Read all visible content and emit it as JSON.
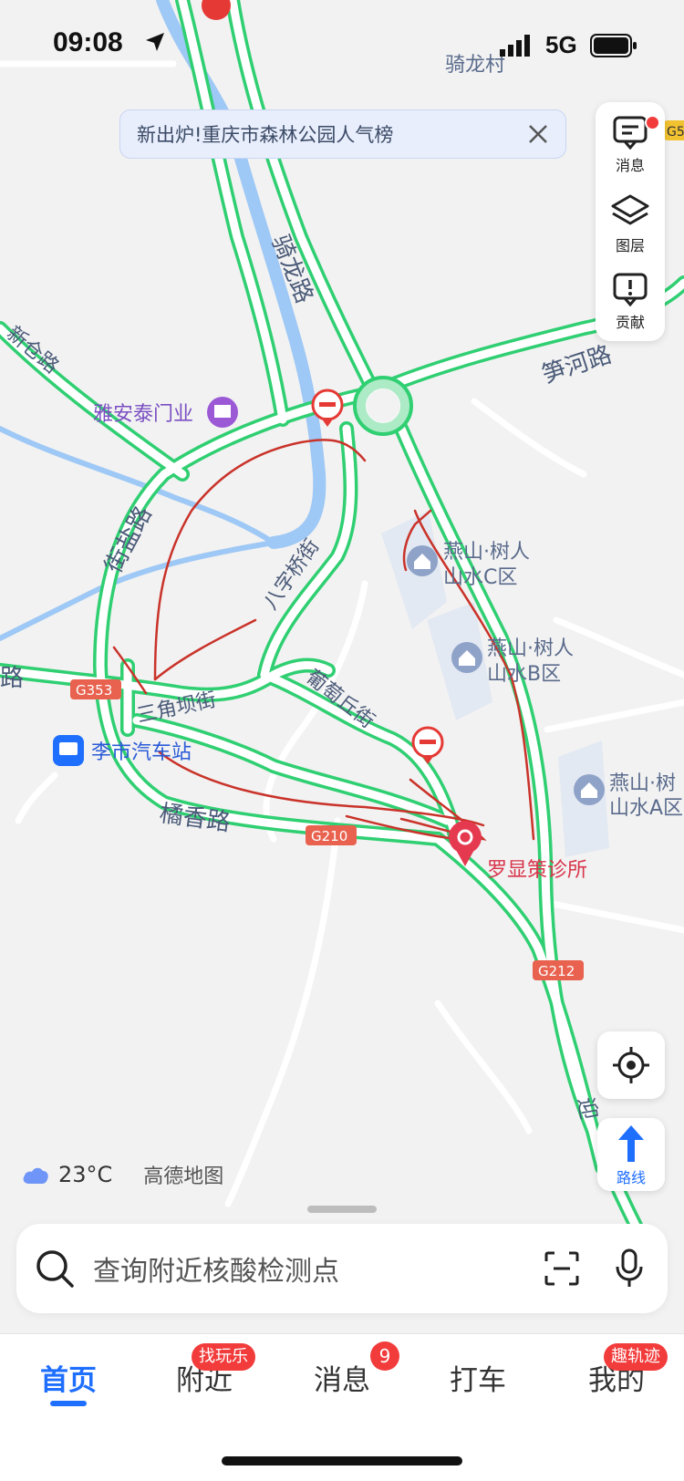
{
  "status": {
    "time": "09:08",
    "network": "5G"
  },
  "banner": {
    "text": "新出炉!重庆市森林公园人气榜"
  },
  "tools": {
    "messages": "消息",
    "layers": "图层",
    "contribute": "贡献"
  },
  "map_labels": {
    "village": "骑龙村",
    "road_qilong": "骑龙路",
    "road_xincang": "新仓路",
    "road_sunhe": "笋河路",
    "poi_yaantai": "雅安泰门业",
    "road_jieyan": "街盐路",
    "road_bazi": "八字桥街",
    "poi_c_line1": "燕山·树人",
    "poi_c_line2": "山水C区",
    "poi_b_line1": "燕山·树人",
    "poi_b_line2": "山水B区",
    "poi_a_line1": "燕山·树",
    "poi_a_line2": "山水A区",
    "road_lu": "路",
    "shield_g353": "G353",
    "road_sanjiao": "三角坝街",
    "road_putao": "葡萄丘街",
    "poi_bus": "李市汽车站",
    "road_juxiang": "橘香路",
    "shield_g210": "G210",
    "poi_clinic": "罗显策诊所",
    "shield_g212": "G212",
    "road_ying": "迎",
    "shield_edge": "G5"
  },
  "weather": {
    "temp": "23°C",
    "brand": "高德地图"
  },
  "route": {
    "label": "路线"
  },
  "search": {
    "placeholder": "查询附近核酸检测点"
  },
  "tabs": [
    {
      "label": "首页"
    },
    {
      "label": "附近",
      "badge": "找玩乐"
    },
    {
      "label": "消息",
      "badge": "9"
    },
    {
      "label": "打车"
    },
    {
      "label": "我的",
      "badge": "趣轨迹"
    }
  ],
  "colors": {
    "road_green": "#2fcf72",
    "river": "#9ec8f5",
    "accent": "#1f6fff",
    "badge": "#f23b3b",
    "annotation": "#c9332a"
  }
}
